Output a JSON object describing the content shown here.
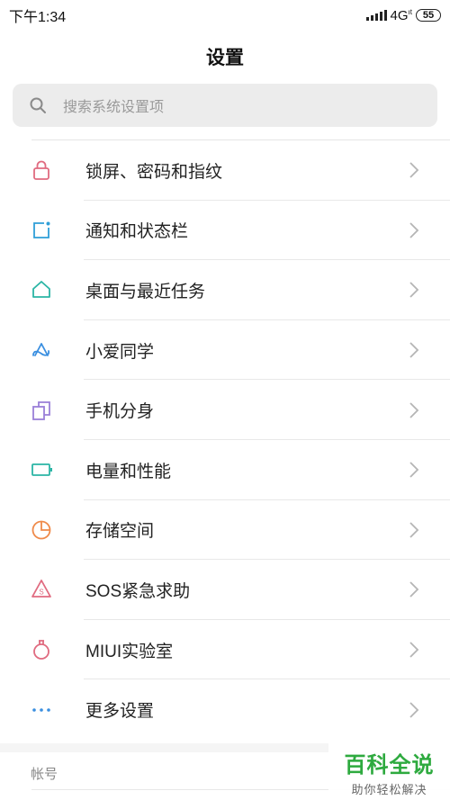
{
  "status_bar": {
    "time": "下午1:34",
    "network": "4G",
    "network_sub": "ıt",
    "battery": "55"
  },
  "header": {
    "title": "设置"
  },
  "search": {
    "placeholder": "搜索系统设置项"
  },
  "settings": [
    {
      "label": "锁屏、密码和指纹",
      "icon": "lock-icon",
      "color": "#e06b80"
    },
    {
      "label": "通知和状态栏",
      "icon": "notification-icon",
      "color": "#2f9fd8"
    },
    {
      "label": "桌面与最近任务",
      "icon": "home-icon",
      "color": "#2bb5a5"
    },
    {
      "label": "小爱同学",
      "icon": "xiaoai-icon",
      "color": "#3a8fe0"
    },
    {
      "label": "手机分身",
      "icon": "second-space-icon",
      "color": "#9a7fd8"
    },
    {
      "label": "电量和性能",
      "icon": "battery-icon",
      "color": "#2bb5a5"
    },
    {
      "label": "存储空间",
      "icon": "storage-icon",
      "color": "#ef8a4a"
    },
    {
      "label": "SOS紧急求助",
      "icon": "sos-icon",
      "color": "#e06b80"
    },
    {
      "label": "MIUI实验室",
      "icon": "lab-icon",
      "color": "#e06b80"
    },
    {
      "label": "更多设置",
      "icon": "more-icon",
      "color": "#3a8fe0"
    }
  ],
  "section": {
    "header": "帐号"
  },
  "watermark": {
    "title": "百科全说",
    "subtitle": "助你轻松解决"
  }
}
